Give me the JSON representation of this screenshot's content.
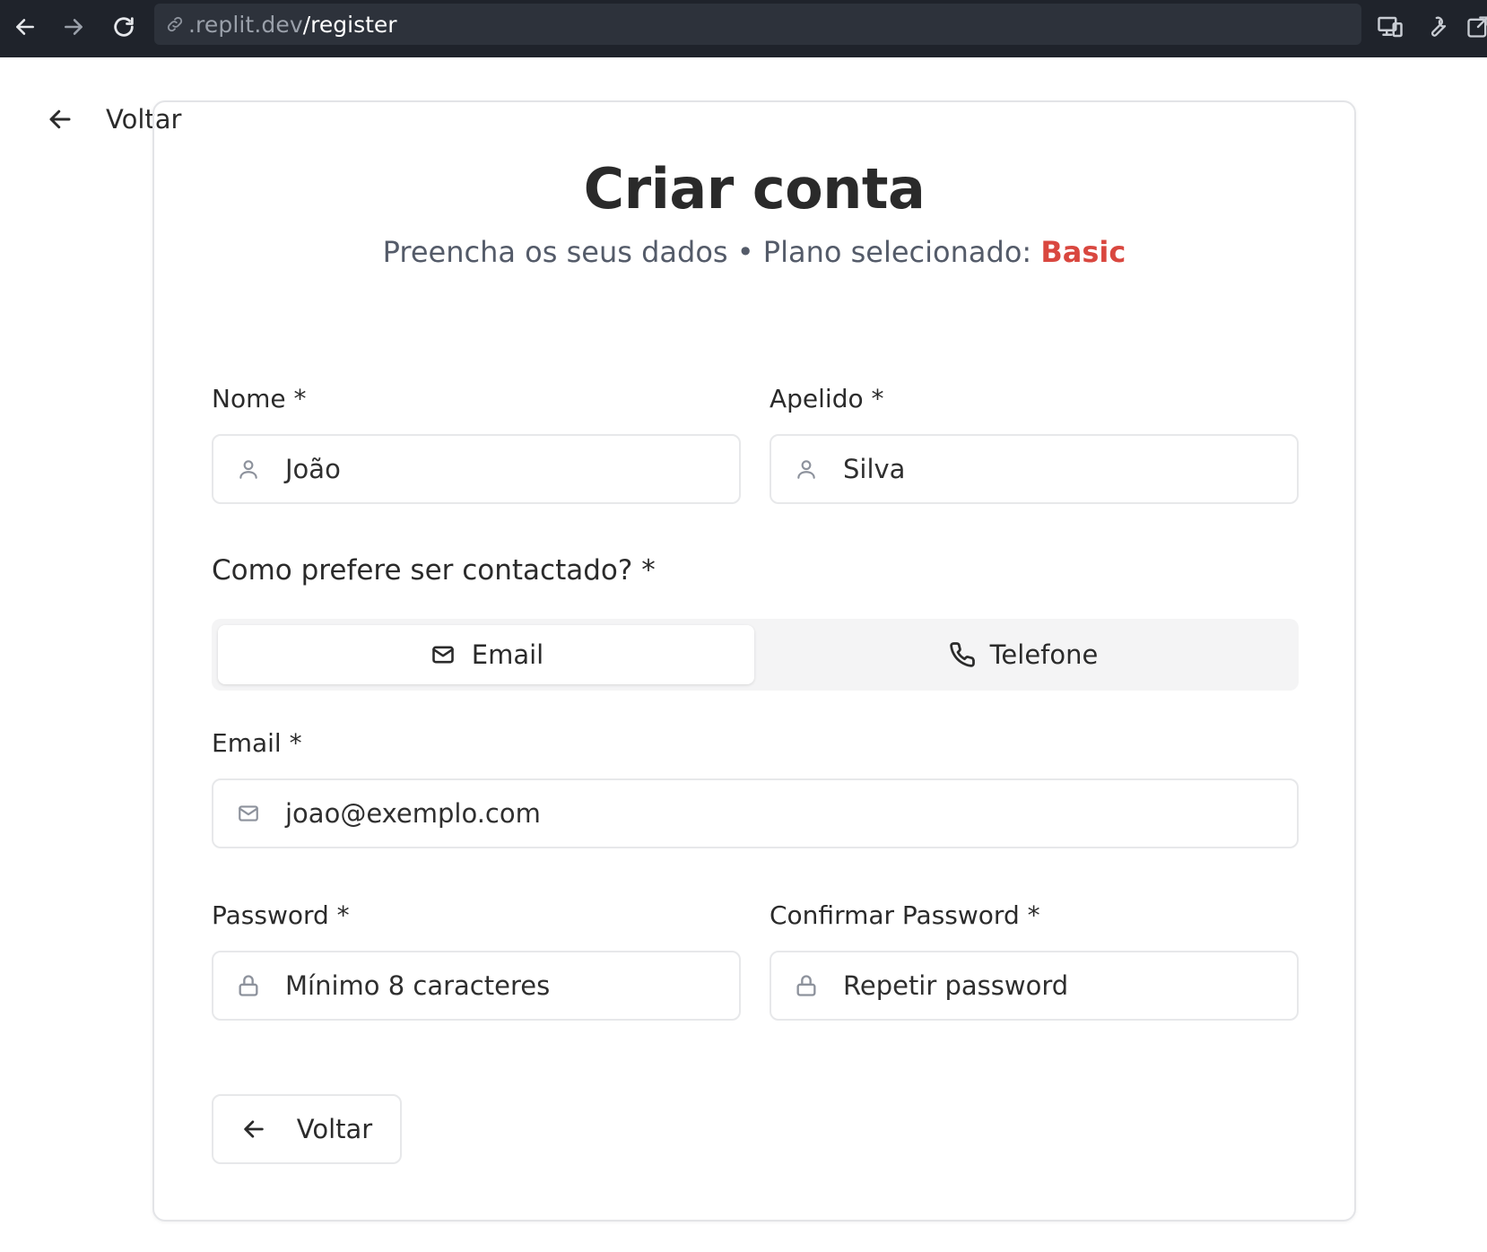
{
  "browser": {
    "url_host": ".replit.dev",
    "url_path": "/register",
    "icons": [
      "back-arrow-icon",
      "forward-arrow-icon",
      "reload-icon",
      "link-icon",
      "devices-icon",
      "wrench-icon",
      "external-window-icon"
    ]
  },
  "header": {
    "back_label": "Voltar"
  },
  "form": {
    "title": "Criar conta",
    "subtitle_prefix": "Preencha os seus dados • Plano selecionado: ",
    "plan": "Basic",
    "plan_color": "#d9473f",
    "first_name": {
      "label": "Nome *",
      "value": "João",
      "icon": "user-icon"
    },
    "last_name": {
      "label": "Apelido *",
      "value": "Silva",
      "icon": "user-icon"
    },
    "contact": {
      "label": "Como prefere ser contactado? *",
      "options": [
        {
          "label": "Email",
          "icon": "mail-icon",
          "selected": true
        },
        {
          "label": "Telefone",
          "icon": "phone-icon",
          "selected": false
        }
      ]
    },
    "email": {
      "label": "Email *",
      "value": "joao@exemplo.com",
      "icon": "mail-icon"
    },
    "password": {
      "label": "Password *",
      "placeholder": "Mínimo 8 caracteres",
      "icon": "lock-icon"
    },
    "confirm_password": {
      "label": "Confirmar Password *",
      "placeholder": "Repetir password",
      "icon": "lock-icon"
    },
    "back_button": "Voltar"
  }
}
